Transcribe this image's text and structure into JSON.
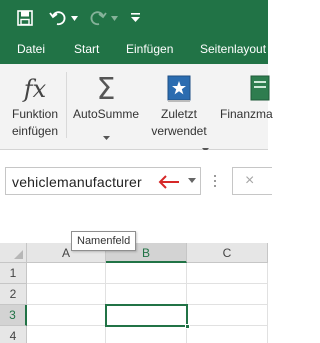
{
  "colors": {
    "accent": "#217346",
    "ribbon_bg": "#f3f3f3",
    "arrow": "#d62828",
    "grid_header_bg": "#e6e6e6"
  },
  "quick_access": {
    "save_icon": "save-icon",
    "undo_icon": "undo-icon",
    "redo_icon": "redo-icon",
    "customize_icon": "customize-qat-icon"
  },
  "tabs": [
    {
      "label": "Datei"
    },
    {
      "label": "Start"
    },
    {
      "label": "Einfügen"
    },
    {
      "label": "Seitenlayout"
    }
  ],
  "ribbon": {
    "function": {
      "icon_text": "fx",
      "line1": "Funktion",
      "line2": "einfügen"
    },
    "autosum": {
      "icon_text": "Σ",
      "line1": "AutoSumme",
      "has_dropdown": true
    },
    "recent": {
      "line1": "Zuletzt",
      "line2": "verwendet",
      "has_dropdown": true
    },
    "finance": {
      "line1": "Finanzma"
    }
  },
  "name_box": {
    "value": "vehiclemanufacturer",
    "tooltip": "Namenfeld"
  },
  "formula_bar": {
    "cancel_glyph": "×"
  },
  "grid": {
    "columns": [
      "A",
      "B",
      "C"
    ],
    "rows": [
      "1",
      "2",
      "3",
      "4"
    ],
    "selected_column": "B",
    "selected_row": "3",
    "active_cell": "B3"
  }
}
